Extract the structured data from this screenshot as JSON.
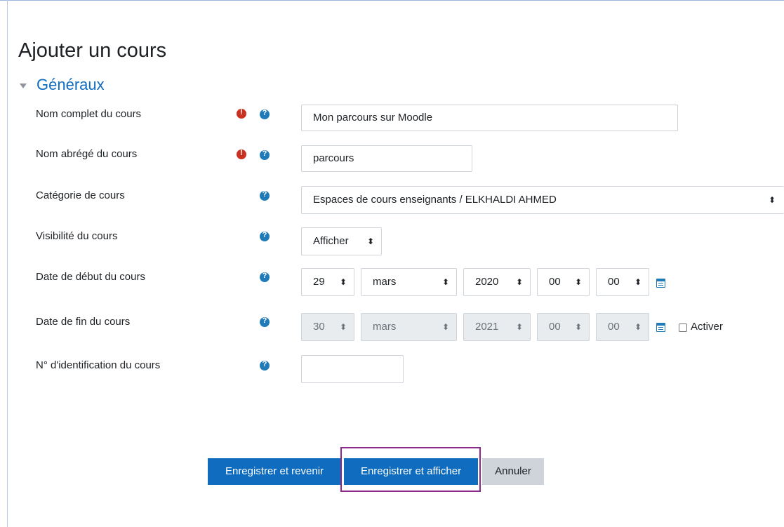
{
  "page": {
    "title": "Ajouter un cours"
  },
  "section": {
    "title": "Généraux"
  },
  "fields": {
    "fullname": {
      "label": "Nom complet du cours",
      "value": "Mon parcours sur Moodle"
    },
    "shortname": {
      "label": "Nom abrégé du cours",
      "value": "parcours"
    },
    "category": {
      "label": "Catégorie de cours",
      "value": "Espaces de cours enseignants / ELKHALDI AHMED"
    },
    "visibility": {
      "label": "Visibilité du cours",
      "value": "Afficher"
    },
    "startdate": {
      "label": "Date de début du cours",
      "day": "29",
      "month": "mars",
      "year": "2020",
      "hour": "00",
      "minute": "00"
    },
    "enddate": {
      "label": "Date de fin du cours",
      "day": "30",
      "month": "mars",
      "year": "2021",
      "hour": "00",
      "minute": "00",
      "enable_label": "Activer",
      "enabled": false
    },
    "idnumber": {
      "label": "N° d'identification du cours",
      "value": ""
    }
  },
  "buttons": {
    "save_return": "Enregistrer et revenir",
    "save_display": "Enregistrer et afficher",
    "cancel": "Annuler"
  },
  "select_arrow": "⬍",
  "colors": {
    "primary": "#0f6cbf",
    "required": "#ca3120",
    "help": "#1f7ab8",
    "highlight": "#8b2a8b"
  }
}
